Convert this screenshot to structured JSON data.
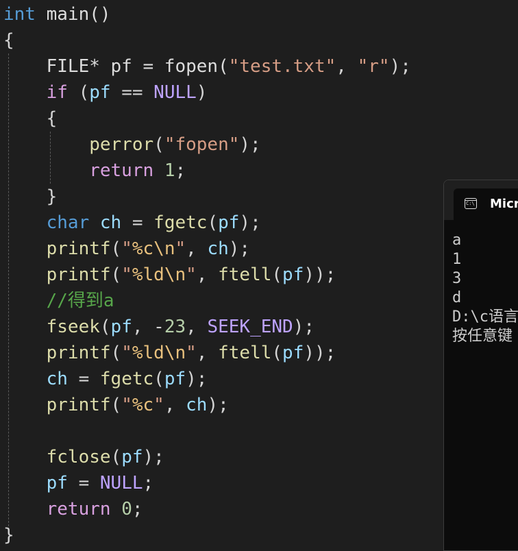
{
  "editor": {
    "lines": [
      [
        {
          "t": "int",
          "c": "kw"
        },
        {
          "t": " main()",
          "c": "plain"
        }
      ],
      [
        {
          "t": "{",
          "c": "punc"
        }
      ],
      [
        {
          "t": "    FILE* pf = fopen(",
          "c": "plain"
        },
        {
          "t": "\"test.txt\"",
          "c": "str"
        },
        {
          "t": ", ",
          "c": "punc"
        },
        {
          "t": "\"r\"",
          "c": "str"
        },
        {
          "t": ");",
          "c": "punc"
        }
      ],
      [
        {
          "t": "    if",
          "c": "ctl"
        },
        {
          "t": " (",
          "c": "punc"
        },
        {
          "t": "pf",
          "c": "var"
        },
        {
          "t": " == ",
          "c": "punc"
        },
        {
          "t": "NULL",
          "c": "mac"
        },
        {
          "t": ")",
          "c": "punc"
        }
      ],
      [
        {
          "t": "    {",
          "c": "punc"
        }
      ],
      [
        {
          "t": "        perror",
          "c": "fn"
        },
        {
          "t": "(",
          "c": "punc"
        },
        {
          "t": "\"fopen\"",
          "c": "str"
        },
        {
          "t": ");",
          "c": "punc"
        }
      ],
      [
        {
          "t": "        return",
          "c": "ctl"
        },
        {
          "t": " ",
          "c": "punc"
        },
        {
          "t": "1",
          "c": "num"
        },
        {
          "t": ";",
          "c": "punc"
        }
      ],
      [
        {
          "t": "    }",
          "c": "punc"
        }
      ],
      [
        {
          "t": "    char",
          "c": "kw"
        },
        {
          "t": " ",
          "c": "punc"
        },
        {
          "t": "ch",
          "c": "var"
        },
        {
          "t": " = ",
          "c": "punc"
        },
        {
          "t": "fgetc",
          "c": "fn"
        },
        {
          "t": "(",
          "c": "punc"
        },
        {
          "t": "pf",
          "c": "var"
        },
        {
          "t": ");",
          "c": "punc"
        }
      ],
      [
        {
          "t": "    printf",
          "c": "fn"
        },
        {
          "t": "(",
          "c": "punc"
        },
        {
          "t": "\"",
          "c": "str"
        },
        {
          "t": "%c\\n",
          "c": "esc"
        },
        {
          "t": "\"",
          "c": "str"
        },
        {
          "t": ", ",
          "c": "punc"
        },
        {
          "t": "ch",
          "c": "var"
        },
        {
          "t": ");",
          "c": "punc"
        }
      ],
      [
        {
          "t": "    printf",
          "c": "fn"
        },
        {
          "t": "(",
          "c": "punc"
        },
        {
          "t": "\"",
          "c": "str"
        },
        {
          "t": "%ld\\n",
          "c": "esc"
        },
        {
          "t": "\"",
          "c": "str"
        },
        {
          "t": ", ",
          "c": "punc"
        },
        {
          "t": "ftell",
          "c": "fn"
        },
        {
          "t": "(",
          "c": "punc"
        },
        {
          "t": "pf",
          "c": "var"
        },
        {
          "t": "));",
          "c": "punc"
        }
      ],
      [
        {
          "t": "    //得到a",
          "c": "cmt"
        }
      ],
      [
        {
          "t": "    fseek",
          "c": "fn"
        },
        {
          "t": "(",
          "c": "punc"
        },
        {
          "t": "pf",
          "c": "var"
        },
        {
          "t": ", -",
          "c": "punc"
        },
        {
          "t": "23",
          "c": "num"
        },
        {
          "t": ", ",
          "c": "punc"
        },
        {
          "t": "SEEK_END",
          "c": "mac"
        },
        {
          "t": ");",
          "c": "punc"
        }
      ],
      [
        {
          "t": "    printf",
          "c": "fn"
        },
        {
          "t": "(",
          "c": "punc"
        },
        {
          "t": "\"",
          "c": "str"
        },
        {
          "t": "%ld\\n",
          "c": "esc"
        },
        {
          "t": "\"",
          "c": "str"
        },
        {
          "t": ", ",
          "c": "punc"
        },
        {
          "t": "ftell",
          "c": "fn"
        },
        {
          "t": "(",
          "c": "punc"
        },
        {
          "t": "pf",
          "c": "var"
        },
        {
          "t": "));",
          "c": "punc"
        }
      ],
      [
        {
          "t": "    ch",
          "c": "var"
        },
        {
          "t": " = ",
          "c": "punc"
        },
        {
          "t": "fgetc",
          "c": "fn"
        },
        {
          "t": "(",
          "c": "punc"
        },
        {
          "t": "pf",
          "c": "var"
        },
        {
          "t": ");",
          "c": "punc"
        }
      ],
      [
        {
          "t": "    printf",
          "c": "fn"
        },
        {
          "t": "(",
          "c": "punc"
        },
        {
          "t": "\"",
          "c": "str"
        },
        {
          "t": "%c",
          "c": "esc"
        },
        {
          "t": "\"",
          "c": "str"
        },
        {
          "t": ", ",
          "c": "punc"
        },
        {
          "t": "ch",
          "c": "var"
        },
        {
          "t": ");",
          "c": "punc"
        }
      ],
      [
        {
          "t": "",
          "c": "plain"
        }
      ],
      [
        {
          "t": "    fclose",
          "c": "fn"
        },
        {
          "t": "(",
          "c": "punc"
        },
        {
          "t": "pf",
          "c": "var"
        },
        {
          "t": ");",
          "c": "punc"
        }
      ],
      [
        {
          "t": "    pf",
          "c": "var"
        },
        {
          "t": " = ",
          "c": "punc"
        },
        {
          "t": "NULL",
          "c": "mac"
        },
        {
          "t": ";",
          "c": "punc"
        }
      ],
      [
        {
          "t": "    return",
          "c": "ctl"
        },
        {
          "t": " ",
          "c": "punc"
        },
        {
          "t": "0",
          "c": "num"
        },
        {
          "t": ";",
          "c": "punc"
        }
      ],
      [
        {
          "t": "}",
          "c": "punc"
        }
      ]
    ]
  },
  "terminal": {
    "icon": "console-icon",
    "title": "Micro",
    "output": [
      "a",
      "1",
      "3",
      "d",
      "D:\\c语言",
      "按任意键"
    ]
  },
  "colors": {
    "background": "#1e1e1e",
    "keyword": "#569cd6",
    "control": "#d8a0df",
    "function": "#dcdcaa",
    "variable": "#9cdcfe",
    "string": "#d69d85",
    "escape": "#e8c07d",
    "number": "#b5cea8",
    "macro": "#bea3ff",
    "comment": "#57a64a",
    "terminal_bg": "#0c0c0c"
  }
}
